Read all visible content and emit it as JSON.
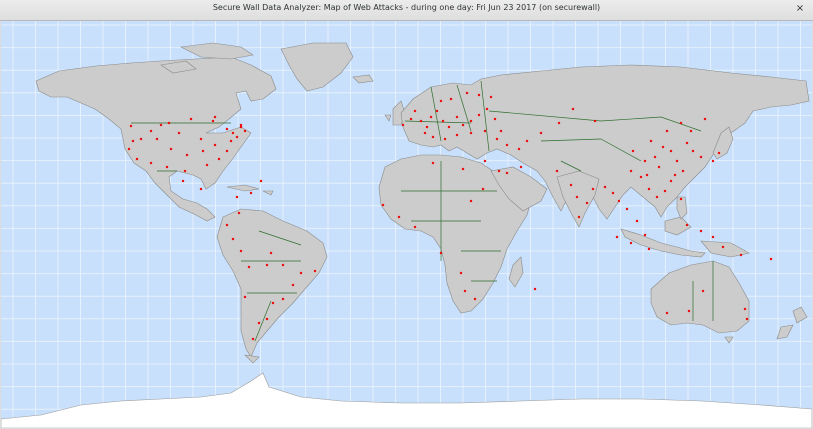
{
  "window": {
    "title": "Secure Wall Data Analyzer: Map of Web Attacks - during one day: Fri Jun 23 2017 (on securewall)",
    "close_glyph": "×"
  },
  "colors": {
    "ocean": "#c8e0fb",
    "grid": "#e6f1fd",
    "land": "#cccccc",
    "border": "#2d6e2d",
    "antarctica": "#ffffff",
    "attack": "#ee1111"
  },
  "icons": {
    "close": "close-icon"
  }
}
